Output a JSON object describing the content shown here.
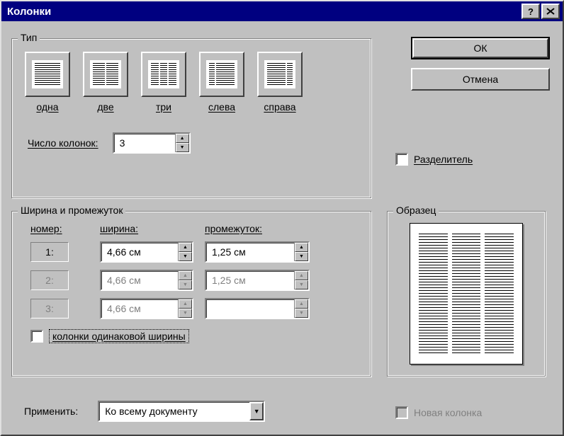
{
  "title": "Колонки",
  "type_group": {
    "legend": "Тип",
    "presets": [
      {
        "key": "one",
        "label": "одна"
      },
      {
        "key": "two",
        "label": "две"
      },
      {
        "key": "three",
        "label": "три"
      },
      {
        "key": "left",
        "label": "слева"
      },
      {
        "key": "right",
        "label": "справа"
      }
    ],
    "num_columns_label": "Число колонок:",
    "num_columns_value": "3"
  },
  "buttons": {
    "ok": "ОК",
    "cancel": "Отмена"
  },
  "separator": {
    "label": "Разделитель",
    "checked": false
  },
  "width_group": {
    "legend": "Ширина и промежуток",
    "col_num_header": "номер:",
    "col_width_header": "ширина:",
    "col_gap_header": "промежуток:",
    "rows": [
      {
        "num": "1:",
        "width": "4,66 см",
        "gap": "1,25 см"
      },
      {
        "num": "2:",
        "width": "4,66 см",
        "gap": "1,25 см"
      },
      {
        "num": "3:",
        "width": "4,66 см",
        "gap": ""
      }
    ],
    "equal_width_label": "колонки одинаковой ширины",
    "equal_width_checked": false
  },
  "preview": {
    "legend": "Образец"
  },
  "apply": {
    "label": "Применить:",
    "value": "Ко всему документу"
  },
  "new_column": {
    "label": "Новая колонка",
    "enabled": false
  }
}
